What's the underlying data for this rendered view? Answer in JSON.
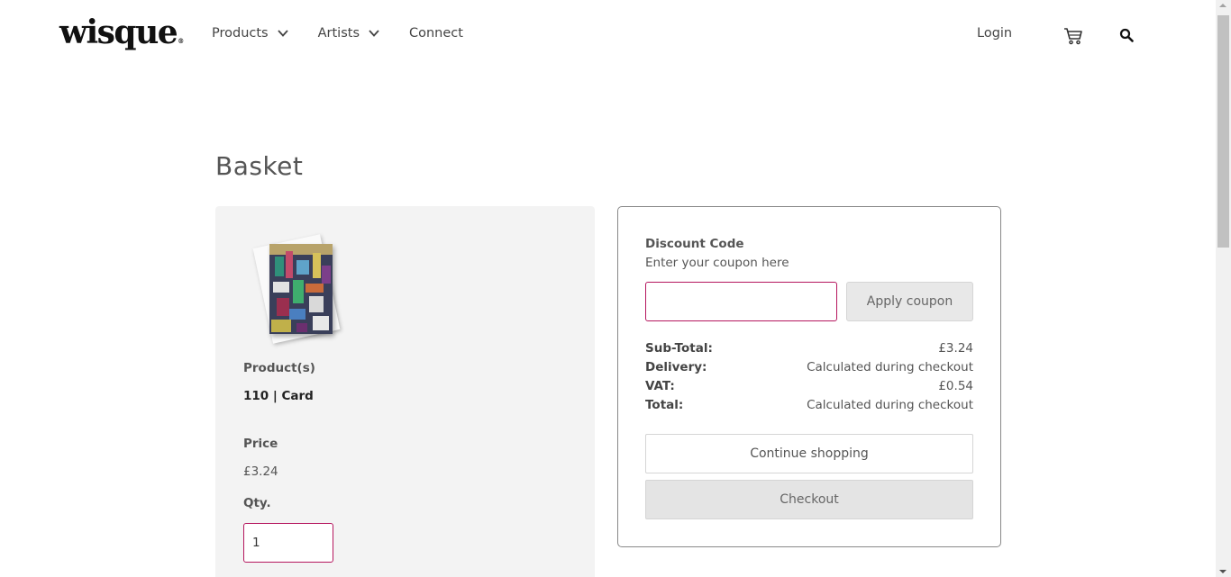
{
  "header": {
    "logo_text": "wisque",
    "logo_mark": "®",
    "nav": [
      {
        "label": "Products",
        "has_dropdown": true
      },
      {
        "label": "Artists",
        "has_dropdown": true
      },
      {
        "label": "Connect",
        "has_dropdown": false
      }
    ],
    "login_label": "Login",
    "cart_icon": "cart-icon",
    "search_icon": "search-icon"
  },
  "page": {
    "title": "Basket"
  },
  "basket_item": {
    "products_label": "Product(s)",
    "product_name": "110 | Card",
    "price_label": "Price",
    "price": "£3.24",
    "qty_label": "Qty.",
    "qty_value": "1"
  },
  "summary": {
    "discount_title": "Discount Code",
    "discount_hint": "Enter your coupon here",
    "coupon_value": "",
    "apply_label": "Apply coupon",
    "rows": [
      {
        "label": "Sub-Total:",
        "value": "£3.24"
      },
      {
        "label": "Delivery:",
        "value": "Calculated during checkout"
      },
      {
        "label": "VAT:",
        "value": "£0.54"
      },
      {
        "label": "Total:",
        "value": "Calculated during checkout"
      }
    ],
    "continue_label": "Continue shopping",
    "checkout_label": "Checkout"
  },
  "colors": {
    "accent": "#b5165e",
    "panel_bg": "#f3f3f3",
    "button_grey": "#e4e4e4"
  }
}
